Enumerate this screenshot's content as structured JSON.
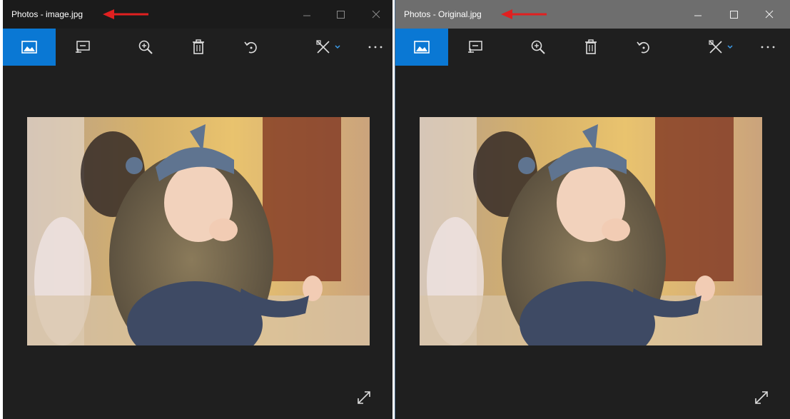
{
  "windows": [
    {
      "title": "Photos - image.jpg",
      "title_bar_color": "#1b1b1b",
      "accent": "#0a78d4",
      "toolbar": {
        "active_button": "view-photo",
        "buttons": [
          "view-photo-icon",
          "slideshow-icon",
          "zoom-icon",
          "delete-icon",
          "rotate-icon",
          "edit-draw-icon",
          "more-icon"
        ]
      }
    },
    {
      "title": "Photos - Original.jpg",
      "title_bar_color": "#6e6e6e",
      "accent": "#0a78d4",
      "toolbar": {
        "active_button": "view-photo",
        "buttons": [
          "view-photo-icon",
          "slideshow-icon",
          "zoom-icon",
          "delete-icon",
          "rotate-icon",
          "edit-draw-icon",
          "more-icon"
        ]
      }
    }
  ],
  "annotation_color": "#e02020"
}
